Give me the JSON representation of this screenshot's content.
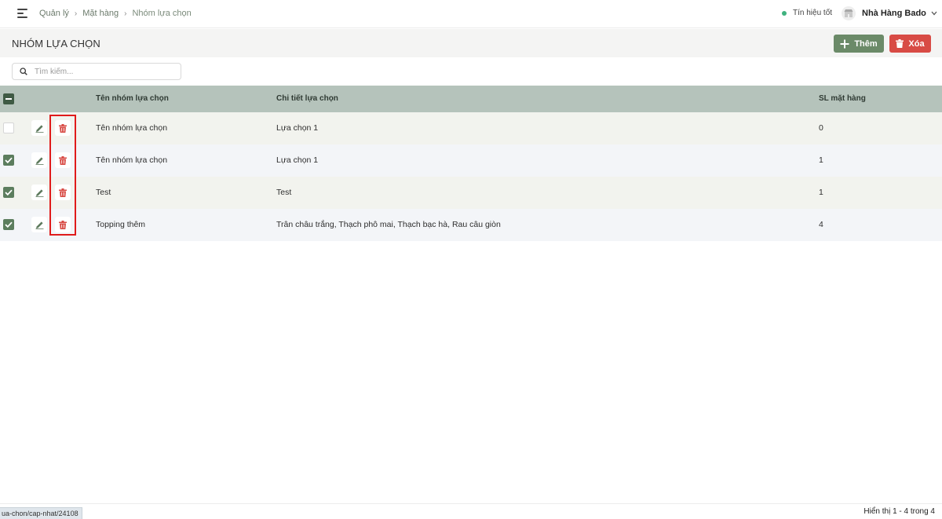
{
  "breadcrumb": [
    "Quản lý",
    "Mặt hàng",
    "Nhóm lựa chọn"
  ],
  "signal": {
    "label": "Tín hiệu tốt",
    "color": "#3fb27f"
  },
  "restaurant": {
    "name": "Nhà Hàng Bado"
  },
  "page": {
    "title": "NHÓM LỰA CHỌN"
  },
  "actions": {
    "add_label": "Thêm",
    "delete_label": "Xóa"
  },
  "search": {
    "placeholder": "Tìm kiếm..."
  },
  "table": {
    "headers": {
      "name": "Tên nhóm lựa chọn",
      "details": "Chi tiết lựa chọn",
      "count": "SL mặt hàng"
    },
    "rows": [
      {
        "checked": false,
        "name": "Tên nhóm lựa chọn",
        "details": "Lựa chọn 1",
        "count": "0"
      },
      {
        "checked": true,
        "name": "Tên nhóm lựa chọn",
        "details": "Lựa chọn 1",
        "count": "1"
      },
      {
        "checked": true,
        "name": "Test",
        "details": "Test",
        "count": "1"
      },
      {
        "checked": true,
        "name": "Topping thêm",
        "details": "Trân châu trắng, Thạch phô mai, Thạch bạc hà, Rau câu giòn",
        "count": "4"
      }
    ]
  },
  "status_url": "ua-chon/cap-nhat/24108",
  "pagination": {
    "text": "Hiển thị 1 - 4 trong 4"
  },
  "colors": {
    "accent": "#6b8a68",
    "danger": "#d84b45",
    "header_bg": "#b5c3bb",
    "highlight": "#e01b1b"
  }
}
